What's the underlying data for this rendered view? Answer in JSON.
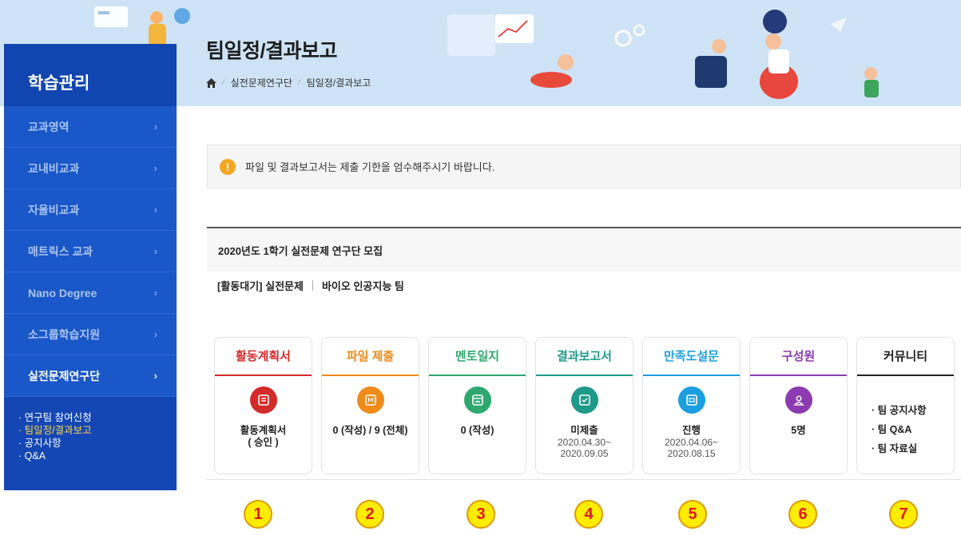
{
  "banner": {
    "title": "팀일정/결과보고",
    "breadcrumb": [
      "실전문제연구단",
      "팀일정/결과보고"
    ]
  },
  "sidebar": {
    "heading": "학습관리",
    "items": [
      {
        "label": "교과영역",
        "active": false
      },
      {
        "label": "교내비교과",
        "active": false
      },
      {
        "label": "자율비교과",
        "active": false
      },
      {
        "label": "매트릭스 교과",
        "active": false
      },
      {
        "label": "Nano Degree",
        "active": false
      },
      {
        "label": "소그룹학습지원",
        "active": false
      },
      {
        "label": "실전문제연구단",
        "active": true
      }
    ],
    "chevron": "›",
    "submenu": [
      "· 연구팀 참여신청",
      "· 팀일정/결과보고",
      "· 공지사항",
      "· Q&A"
    ]
  },
  "notice": {
    "icon": "warning-icon",
    "icon_glyph": "!",
    "text": "파일 및 결과보고서는 제출 기한을 엄수해주시기 바랍니다."
  },
  "recruit": {
    "title": "2020년도 1학기 실전문제 연구단 모집",
    "status": "[활동대기] 실전문제",
    "team": "바이오 인공지능 팀"
  },
  "cards": [
    {
      "title": "활동계획서",
      "color": "#d42a2a",
      "main": "활동계획서",
      "sub1": "( 승인 )",
      "sub2": ""
    },
    {
      "title": "파일 제출",
      "color": "#ef8b1a",
      "main": "0 (작성) / 9 (전체)",
      "sub1": "",
      "sub2": ""
    },
    {
      "title": "멘토일지",
      "color": "#2fa86f",
      "main": "0 (작성)",
      "sub1": "",
      "sub2": ""
    },
    {
      "title": "결과보고서",
      "color": "#1f9a8a",
      "main": "미제출",
      "sub1": "2020.04.30~",
      "sub2": "2020.09.05"
    },
    {
      "title": "만족도설문",
      "color": "#1b9fe0",
      "main": "진행",
      "sub1": "2020.04.06~",
      "sub2": "2020.08.15"
    },
    {
      "title": "구성원",
      "color": "#8c3bb0",
      "main": "5명",
      "sub1": "",
      "sub2": ""
    }
  ],
  "community": {
    "title": "커뮤니티",
    "color": "#222222",
    "links": [
      "· 팀 공지사항",
      "· 팀 Q&A",
      "· 팀 자료실"
    ]
  },
  "numbers": [
    "1",
    "2",
    "3",
    "4",
    "5",
    "6",
    "7"
  ]
}
